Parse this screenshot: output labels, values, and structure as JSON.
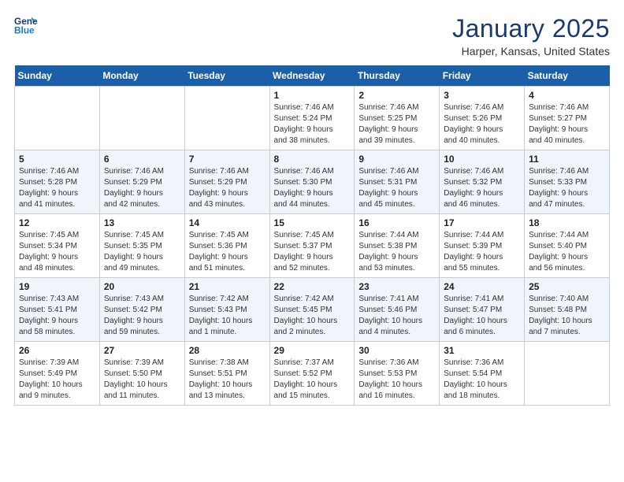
{
  "logo": {
    "line1": "General",
    "line2": "Blue"
  },
  "title": "January 2025",
  "subtitle": "Harper, Kansas, United States",
  "days_of_week": [
    "Sunday",
    "Monday",
    "Tuesday",
    "Wednesday",
    "Thursday",
    "Friday",
    "Saturday"
  ],
  "weeks": [
    [
      {
        "day": "",
        "info": ""
      },
      {
        "day": "",
        "info": ""
      },
      {
        "day": "",
        "info": ""
      },
      {
        "day": "1",
        "info": "Sunrise: 7:46 AM\nSunset: 5:24 PM\nDaylight: 9 hours\nand 38 minutes."
      },
      {
        "day": "2",
        "info": "Sunrise: 7:46 AM\nSunset: 5:25 PM\nDaylight: 9 hours\nand 39 minutes."
      },
      {
        "day": "3",
        "info": "Sunrise: 7:46 AM\nSunset: 5:26 PM\nDaylight: 9 hours\nand 40 minutes."
      },
      {
        "day": "4",
        "info": "Sunrise: 7:46 AM\nSunset: 5:27 PM\nDaylight: 9 hours\nand 40 minutes."
      }
    ],
    [
      {
        "day": "5",
        "info": "Sunrise: 7:46 AM\nSunset: 5:28 PM\nDaylight: 9 hours\nand 41 minutes."
      },
      {
        "day": "6",
        "info": "Sunrise: 7:46 AM\nSunset: 5:29 PM\nDaylight: 9 hours\nand 42 minutes."
      },
      {
        "day": "7",
        "info": "Sunrise: 7:46 AM\nSunset: 5:29 PM\nDaylight: 9 hours\nand 43 minutes."
      },
      {
        "day": "8",
        "info": "Sunrise: 7:46 AM\nSunset: 5:30 PM\nDaylight: 9 hours\nand 44 minutes."
      },
      {
        "day": "9",
        "info": "Sunrise: 7:46 AM\nSunset: 5:31 PM\nDaylight: 9 hours\nand 45 minutes."
      },
      {
        "day": "10",
        "info": "Sunrise: 7:46 AM\nSunset: 5:32 PM\nDaylight: 9 hours\nand 46 minutes."
      },
      {
        "day": "11",
        "info": "Sunrise: 7:46 AM\nSunset: 5:33 PM\nDaylight: 9 hours\nand 47 minutes."
      }
    ],
    [
      {
        "day": "12",
        "info": "Sunrise: 7:45 AM\nSunset: 5:34 PM\nDaylight: 9 hours\nand 48 minutes."
      },
      {
        "day": "13",
        "info": "Sunrise: 7:45 AM\nSunset: 5:35 PM\nDaylight: 9 hours\nand 49 minutes."
      },
      {
        "day": "14",
        "info": "Sunrise: 7:45 AM\nSunset: 5:36 PM\nDaylight: 9 hours\nand 51 minutes."
      },
      {
        "day": "15",
        "info": "Sunrise: 7:45 AM\nSunset: 5:37 PM\nDaylight: 9 hours\nand 52 minutes."
      },
      {
        "day": "16",
        "info": "Sunrise: 7:44 AM\nSunset: 5:38 PM\nDaylight: 9 hours\nand 53 minutes."
      },
      {
        "day": "17",
        "info": "Sunrise: 7:44 AM\nSunset: 5:39 PM\nDaylight: 9 hours\nand 55 minutes."
      },
      {
        "day": "18",
        "info": "Sunrise: 7:44 AM\nSunset: 5:40 PM\nDaylight: 9 hours\nand 56 minutes."
      }
    ],
    [
      {
        "day": "19",
        "info": "Sunrise: 7:43 AM\nSunset: 5:41 PM\nDaylight: 9 hours\nand 58 minutes."
      },
      {
        "day": "20",
        "info": "Sunrise: 7:43 AM\nSunset: 5:42 PM\nDaylight: 9 hours\nand 59 minutes."
      },
      {
        "day": "21",
        "info": "Sunrise: 7:42 AM\nSunset: 5:43 PM\nDaylight: 10 hours\nand 1 minute."
      },
      {
        "day": "22",
        "info": "Sunrise: 7:42 AM\nSunset: 5:45 PM\nDaylight: 10 hours\nand 2 minutes."
      },
      {
        "day": "23",
        "info": "Sunrise: 7:41 AM\nSunset: 5:46 PM\nDaylight: 10 hours\nand 4 minutes."
      },
      {
        "day": "24",
        "info": "Sunrise: 7:41 AM\nSunset: 5:47 PM\nDaylight: 10 hours\nand 6 minutes."
      },
      {
        "day": "25",
        "info": "Sunrise: 7:40 AM\nSunset: 5:48 PM\nDaylight: 10 hours\nand 7 minutes."
      }
    ],
    [
      {
        "day": "26",
        "info": "Sunrise: 7:39 AM\nSunset: 5:49 PM\nDaylight: 10 hours\nand 9 minutes."
      },
      {
        "day": "27",
        "info": "Sunrise: 7:39 AM\nSunset: 5:50 PM\nDaylight: 10 hours\nand 11 minutes."
      },
      {
        "day": "28",
        "info": "Sunrise: 7:38 AM\nSunset: 5:51 PM\nDaylight: 10 hours\nand 13 minutes."
      },
      {
        "day": "29",
        "info": "Sunrise: 7:37 AM\nSunset: 5:52 PM\nDaylight: 10 hours\nand 15 minutes."
      },
      {
        "day": "30",
        "info": "Sunrise: 7:36 AM\nSunset: 5:53 PM\nDaylight: 10 hours\nand 16 minutes."
      },
      {
        "day": "31",
        "info": "Sunrise: 7:36 AM\nSunset: 5:54 PM\nDaylight: 10 hours\nand 18 minutes."
      },
      {
        "day": "",
        "info": ""
      }
    ]
  ]
}
